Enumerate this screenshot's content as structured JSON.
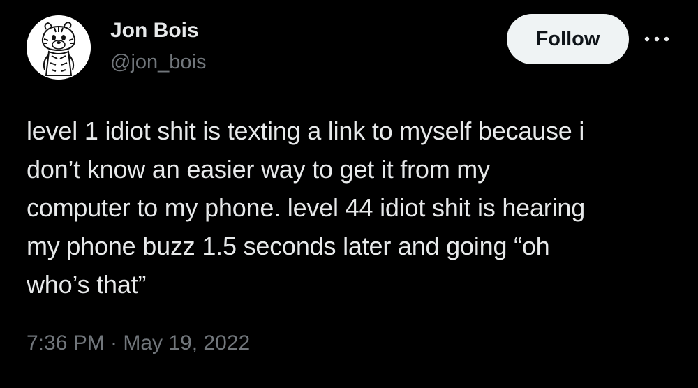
{
  "author": {
    "display_name": "Jon Bois",
    "handle": "@jon_bois",
    "avatar_icon": "cartoon-tiger-avatar-icon"
  },
  "actions": {
    "follow_label": "Follow",
    "more_icon": "more-options-icon"
  },
  "tweet": {
    "lines": [
      "level 1 idiot shit is texting a link to myself because i",
      "don’t know an easier way to get it from my",
      "computer to my phone. level 44 idiot shit is hearing",
      "my phone buzz 1.5 seconds later and going “oh",
      "who’s that”"
    ],
    "timestamp": "7:36 PM · May 19, 2022"
  },
  "colors": {
    "background": "#000000",
    "text_primary": "#e7e9ea",
    "text_secondary": "#71767b",
    "follow_bg": "#eff3f4",
    "follow_text": "#0f1419"
  }
}
